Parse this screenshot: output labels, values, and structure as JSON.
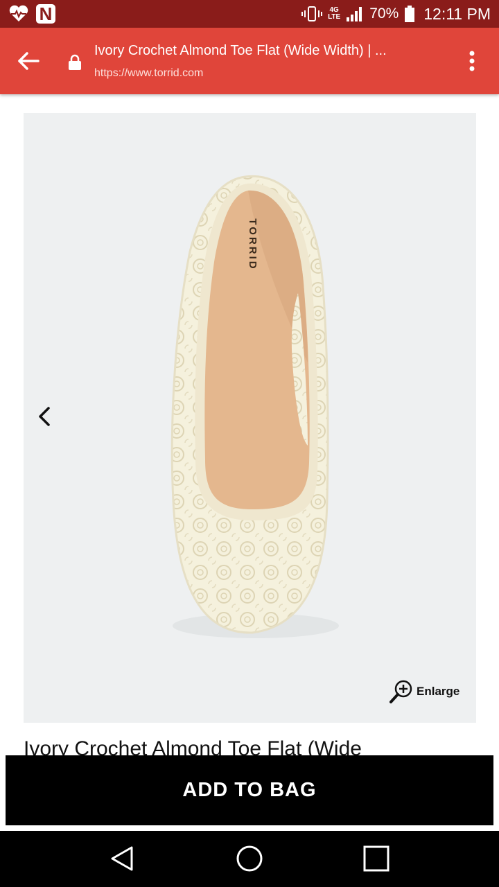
{
  "status_bar": {
    "battery_percent": "70%",
    "time": "12:11 PM",
    "network": "4G",
    "network_sub": "LTE",
    "icons": [
      "heart-pulse-icon",
      "n-app-icon",
      "vibrate-icon",
      "signal-icon",
      "battery-icon"
    ]
  },
  "browser": {
    "page_title": "Ivory Crochet Almond Toe Flat (Wide Width) | ...",
    "url": "https://www.torrid.com",
    "icons": [
      "back-arrow-icon",
      "lock-icon",
      "overflow-menu-icon"
    ]
  },
  "product": {
    "insole_brand": "TORRID",
    "enlarge_label": "Enlarge",
    "title": "Ivory Crochet Almond Toe Flat (Wide",
    "add_to_bag_label": "ADD TO BAG"
  },
  "nav_bar": {
    "icons": [
      "back-triangle-icon",
      "home-circle-icon",
      "recents-square-icon"
    ]
  },
  "colors": {
    "status_bar": "#8a1c1a",
    "toolbar": "#e0453a",
    "add_to_bag_bg": "#000000",
    "image_bg": "#eef0f1",
    "shoe_lace": "#f3efd9",
    "insole": "#e4b78e"
  }
}
